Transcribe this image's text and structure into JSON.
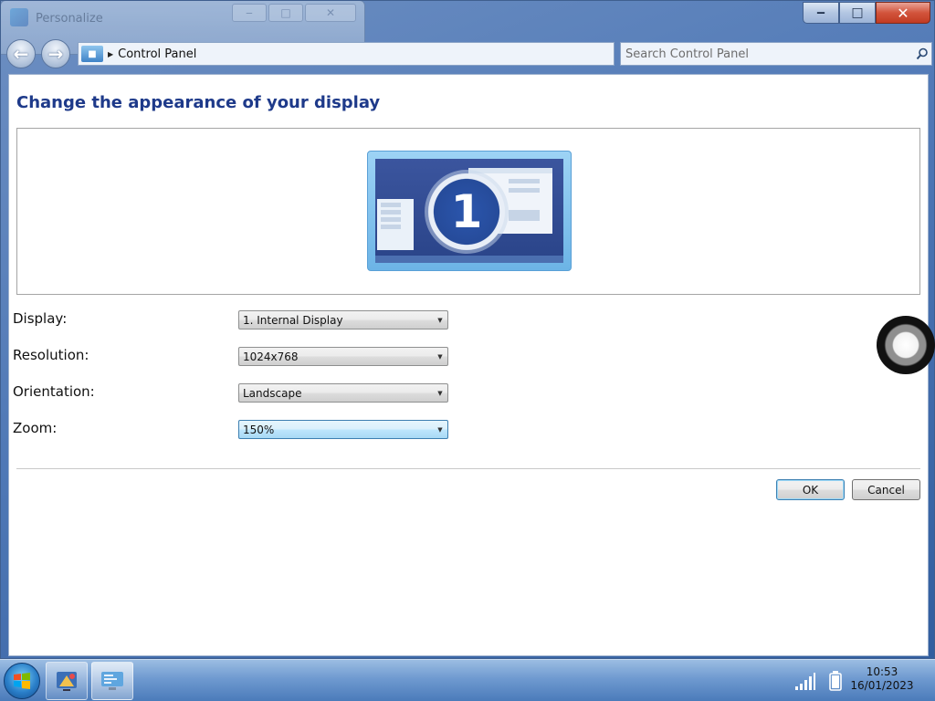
{
  "background_window": {
    "title": "Personalize"
  },
  "window": {
    "caption": {
      "minimize": "‒",
      "maximize": "□",
      "close": "✕"
    }
  },
  "navbar": {
    "back_icon": "back-arrow-icon",
    "forward_icon": "forward-arrow-icon",
    "breadcrumb": "Control Panel",
    "search_placeholder": "Search Control Panel"
  },
  "main": {
    "title": "Change the appearance of your display",
    "monitor_number": "1",
    "settings": [
      {
        "label": "Display:",
        "value": "1. Internal Display"
      },
      {
        "label": "Resolution:",
        "value": "1024x768"
      },
      {
        "label": "Orientation:",
        "value": "Landscape"
      },
      {
        "label": "Zoom:",
        "value": "150%"
      }
    ],
    "ok_label": "OK",
    "cancel_label": "Cancel"
  },
  "taskbar": {
    "time": "10:53",
    "date": "16/01/2023"
  },
  "colors": {
    "title_text": "#1e3a8a",
    "close_button": "#c23b22",
    "active_dropdown": "#a7d9f5"
  }
}
